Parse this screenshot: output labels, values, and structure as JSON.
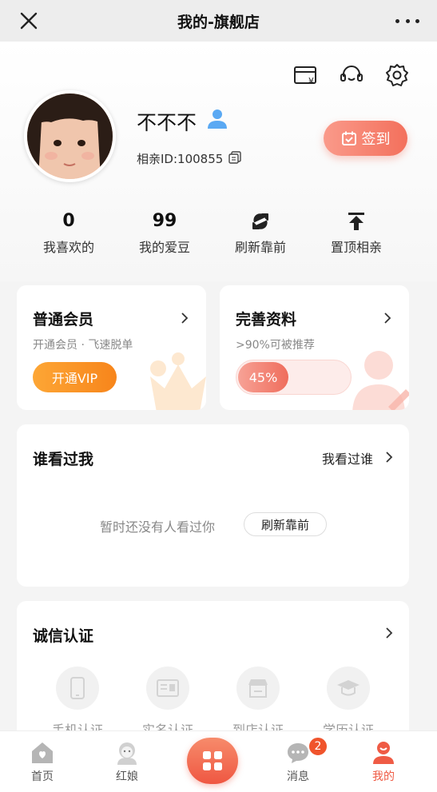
{
  "topbar": {
    "title": "我的-旗舰店"
  },
  "profile": {
    "name": "不不不",
    "id_text": "相亲ID:100855",
    "checkin_label": "签到"
  },
  "stats": [
    {
      "value": "0",
      "label": "我喜欢的"
    },
    {
      "value": "99",
      "label": "我的爱豆"
    },
    {
      "icon": "refresh-icon",
      "label": "刷新靠前"
    },
    {
      "icon": "pin-top-icon",
      "label": "置顶相亲"
    }
  ],
  "member_card": {
    "title": "普通会员",
    "subtitle": "开通会员 · 飞速脱单",
    "button": "开通VIP"
  },
  "profile_card": {
    "title": "完善资料",
    "subtitle": ">90%可被推荐",
    "progress_label": "45%",
    "progress": 0.45
  },
  "visitors": {
    "title": "谁看过我",
    "link": "我看过谁",
    "empty_text": "暂时还没有人看过你",
    "refresh_button": "刷新靠前"
  },
  "certification": {
    "title": "诚信认证",
    "items": [
      {
        "label": "手机认证",
        "icon": "phone-icon"
      },
      {
        "label": "实名认证",
        "icon": "id-card-icon"
      },
      {
        "label": "到店认证",
        "icon": "store-icon"
      },
      {
        "label": "学历认证",
        "icon": "graduation-cap-icon"
      }
    ]
  },
  "tabbar": {
    "items": [
      {
        "label": "首页"
      },
      {
        "label": "红娘"
      },
      {
        "label": "消息",
        "badge": "2"
      },
      {
        "label": "我的"
      }
    ]
  },
  "colors": {
    "accent": "#ef5b45",
    "orange": "#f7851b"
  }
}
